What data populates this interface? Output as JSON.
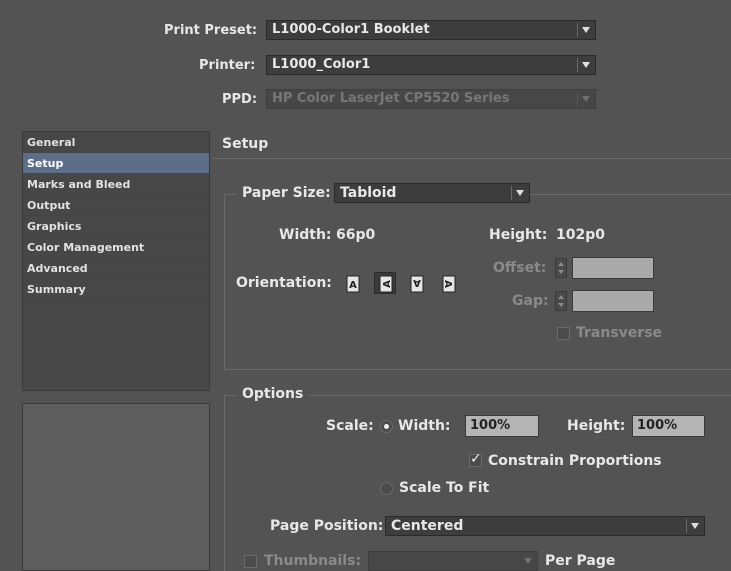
{
  "top": {
    "print_preset_label": "Print Preset:",
    "print_preset_value": "L1000-Color1 Booklet",
    "printer_label": "Printer:",
    "printer_value": "L1000_Color1",
    "ppd_label": "PPD:",
    "ppd_value": "HP Color LaserJet CP5520 Series"
  },
  "sidebar": {
    "items": [
      {
        "label": "General"
      },
      {
        "label": "Setup"
      },
      {
        "label": "Marks and Bleed"
      },
      {
        "label": "Output"
      },
      {
        "label": "Graphics"
      },
      {
        "label": "Color Management"
      },
      {
        "label": "Advanced"
      },
      {
        "label": "Summary"
      }
    ],
    "selected": "Setup"
  },
  "section_title": "Setup",
  "paper": {
    "size_label": "Paper Size:",
    "size_value": "Tabloid",
    "width_label": "Width:",
    "width_value": "66p0",
    "height_label": "Height:",
    "height_value": "102p0",
    "orientation_label": "Orientation:",
    "offset_label": "Offset:",
    "gap_label": "Gap:",
    "transverse_label": "Transverse"
  },
  "options": {
    "group_label": "Options",
    "scale_label": "Scale:",
    "width_radio_label": "Width:",
    "width_value": "100%",
    "height_label": "Height:",
    "height_value": "100%",
    "constrain_label": "Constrain Proportions",
    "scale_to_fit_label": "Scale To Fit",
    "page_position_label": "Page Position:",
    "page_position_value": "Centered",
    "thumbnails_label": "Thumbnails:",
    "per_page_label": "Per Page"
  },
  "icons": {
    "orientation": [
      "portrait-icon",
      "landscape-icon",
      "reverse-portrait-icon",
      "reverse-landscape-icon"
    ]
  },
  "colors": {
    "background": "#535353",
    "selection": "#5c6e8a"
  }
}
